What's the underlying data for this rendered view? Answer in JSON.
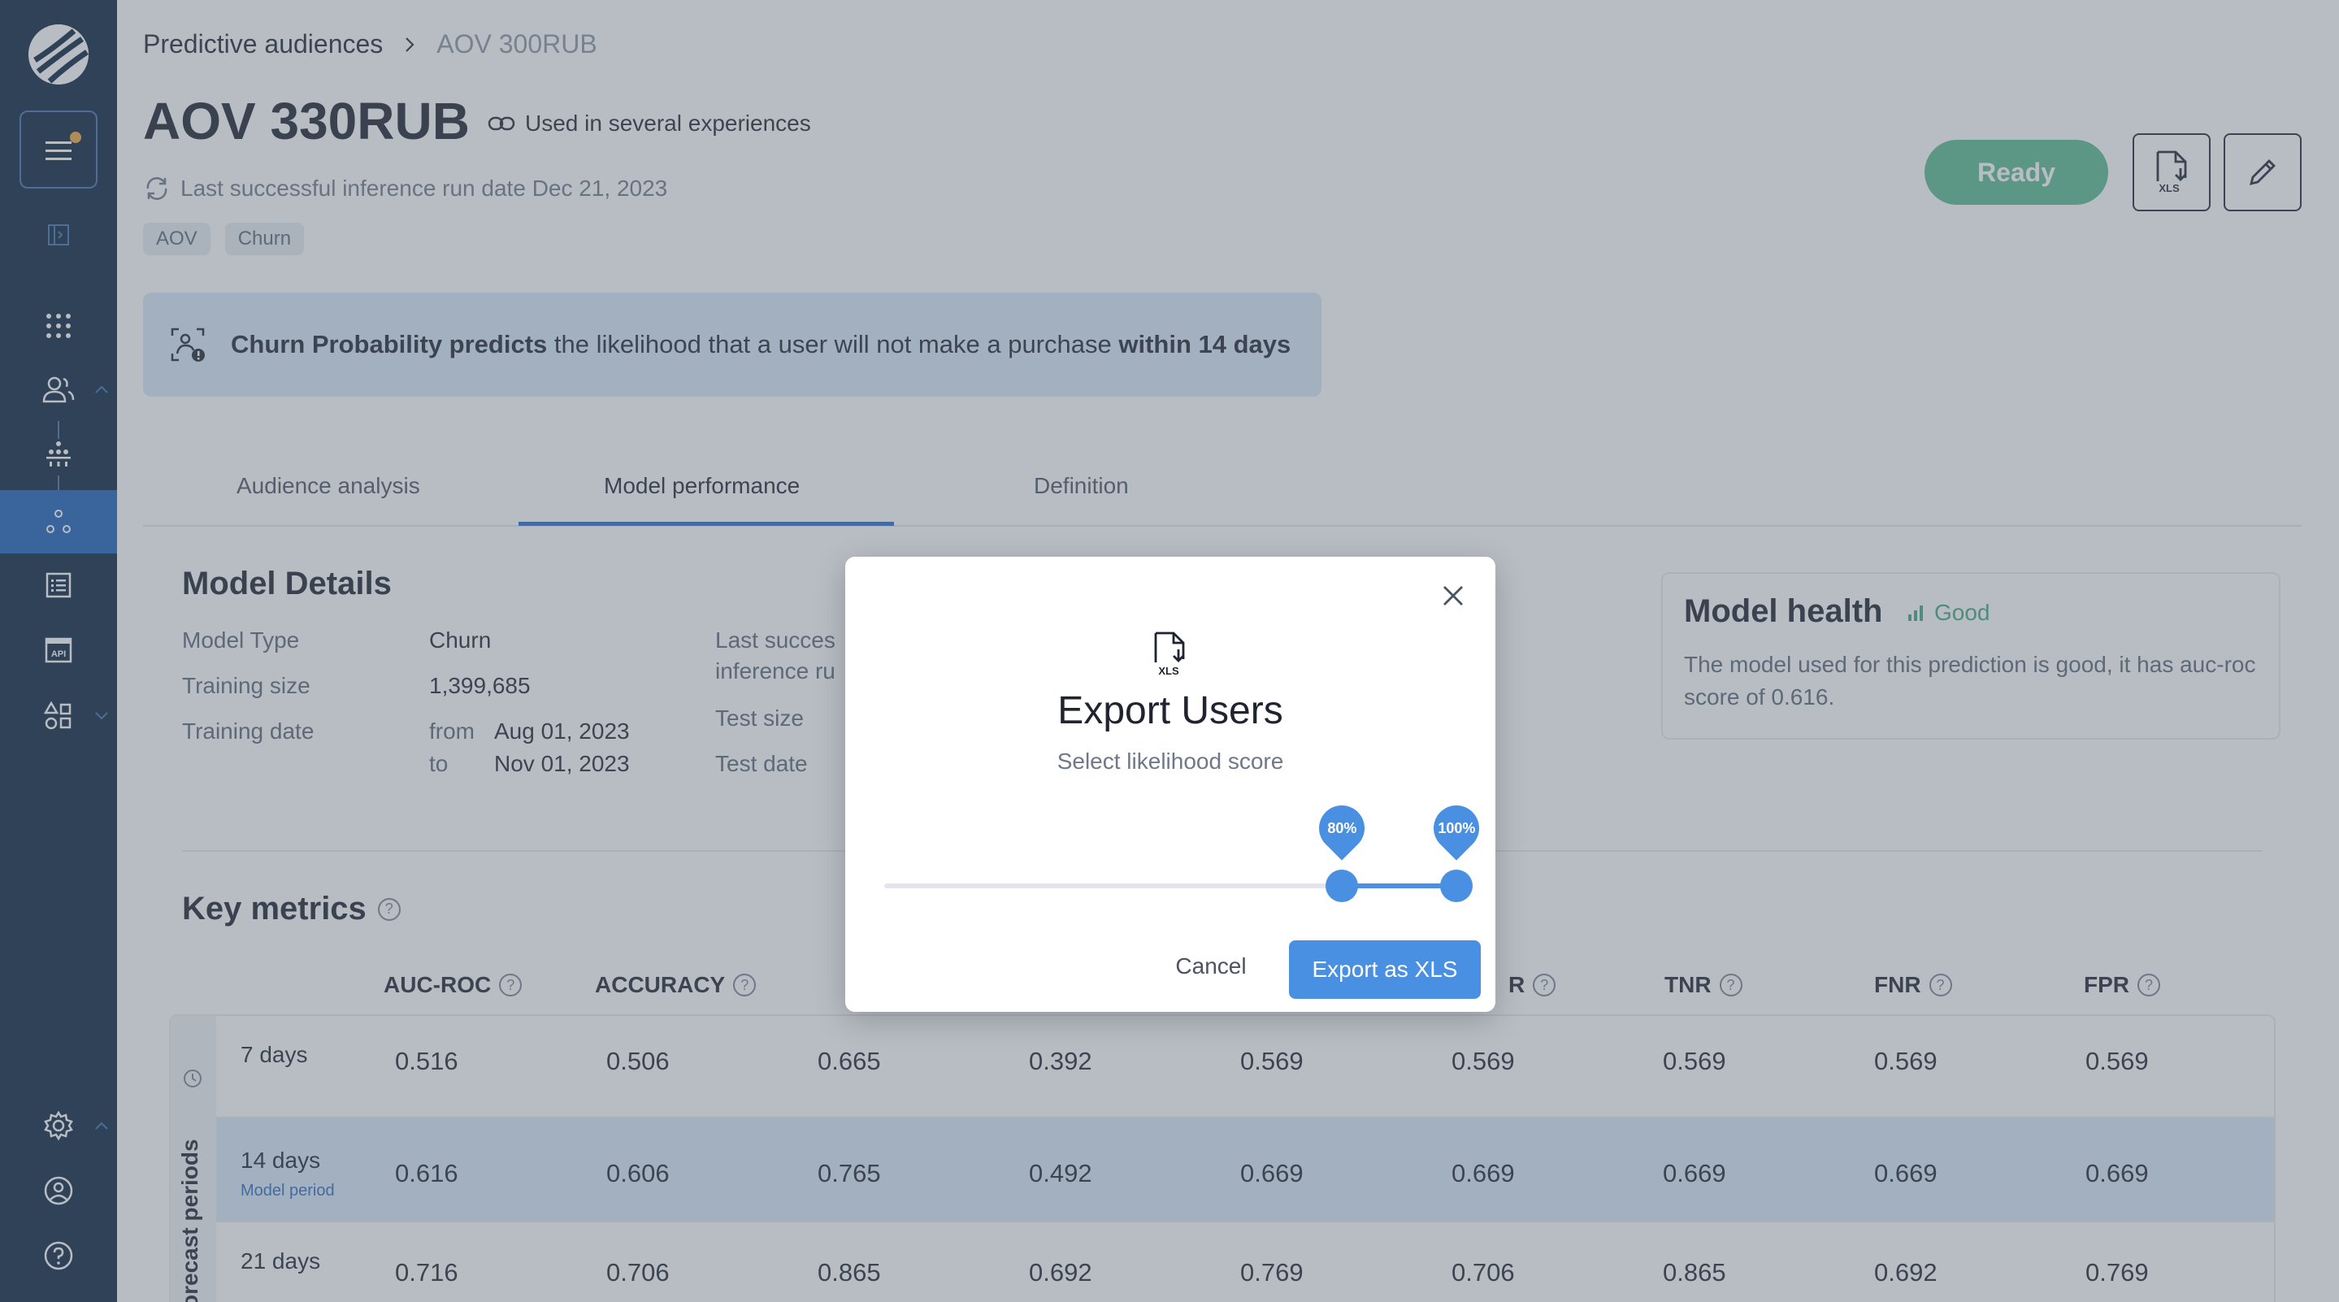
{
  "breadcrumb": {
    "root": "Predictive audiences",
    "current": "AOV 300RUB"
  },
  "page": {
    "title": "AOV 330RUB",
    "used_in": "Used in several experiences",
    "last_run": "Last successful inference run date Dec 21, 2023",
    "tags": [
      "AOV",
      "Churn"
    ],
    "status": "Ready"
  },
  "banner": {
    "bold1": "Churn Probability predicts",
    "text": " the likelihood that a user will not make a purchase ",
    "bold2": "within 14 days"
  },
  "tabs": [
    "Audience analysis",
    "Model performance",
    "Definition"
  ],
  "active_tab": "Model performance",
  "model_details": {
    "title": "Model Details",
    "type_label": "Model Type",
    "type_value": "Churn",
    "size_label": "Training size",
    "size_value": "1,399,685",
    "date_label": "Training date",
    "from_label": "from",
    "from_value": "Aug 01, 2023",
    "to_label": "to",
    "to_value": "Nov 01, 2023",
    "last_run_label_1": "Last succes",
    "last_run_label_2": "inference ru",
    "test_size_label": "Test size",
    "test_date_label": "Test date"
  },
  "model_health": {
    "title": "Model health",
    "status": "Good",
    "description": "The model used for this prediction is good, it has auc-roc score of 0.616."
  },
  "key_metrics": {
    "title": "Key metrics",
    "side_label": "orecast periods",
    "columns": [
      "AUC-ROC",
      "ACCURACY",
      "PI",
      "",
      "",
      "R",
      "TNR",
      "FNR",
      "FPR"
    ],
    "rows": [
      {
        "label": "7 days",
        "sub": "",
        "values": [
          "0.516",
          "0.506",
          "0.665",
          "0.392",
          "0.569",
          "0.569",
          "0.569",
          "0.569",
          "0.569"
        ]
      },
      {
        "label": "14 days",
        "sub": "Model period",
        "values": [
          "0.616",
          "0.606",
          "0.765",
          "0.492",
          "0.669",
          "0.669",
          "0.669",
          "0.669",
          "0.669"
        ]
      },
      {
        "label": "21 days",
        "sub": "",
        "values": [
          "0.716",
          "0.706",
          "0.865",
          "0.692",
          "0.769",
          "0.706",
          "0.865",
          "0.692",
          "0.769"
        ]
      }
    ]
  },
  "modal": {
    "icon_label": "XLS",
    "title": "Export Users",
    "subtitle": "Select likelihood score",
    "slider_min_label": "80%",
    "slider_max_label": "100%",
    "slider_min_value": 80,
    "slider_max_value": 100,
    "cancel": "Cancel",
    "export": "Export as XLS"
  },
  "xls_button_label": "XLS",
  "colors": {
    "sidebar": "#0a1f3c",
    "accent": "#4a90e2",
    "ready": "#5aba8f",
    "good": "#3fa878"
  },
  "icons": {
    "sidebar": [
      "logo-icon",
      "menu-icon",
      "sidebar-toggle-icon",
      "apps-grid-icon",
      "audiences-icon",
      "hierarchy-icon",
      "predictive-icon",
      "list-icon",
      "api-icon",
      "shapes-icon",
      "settings-icon",
      "account-icon",
      "help-icon"
    ]
  }
}
